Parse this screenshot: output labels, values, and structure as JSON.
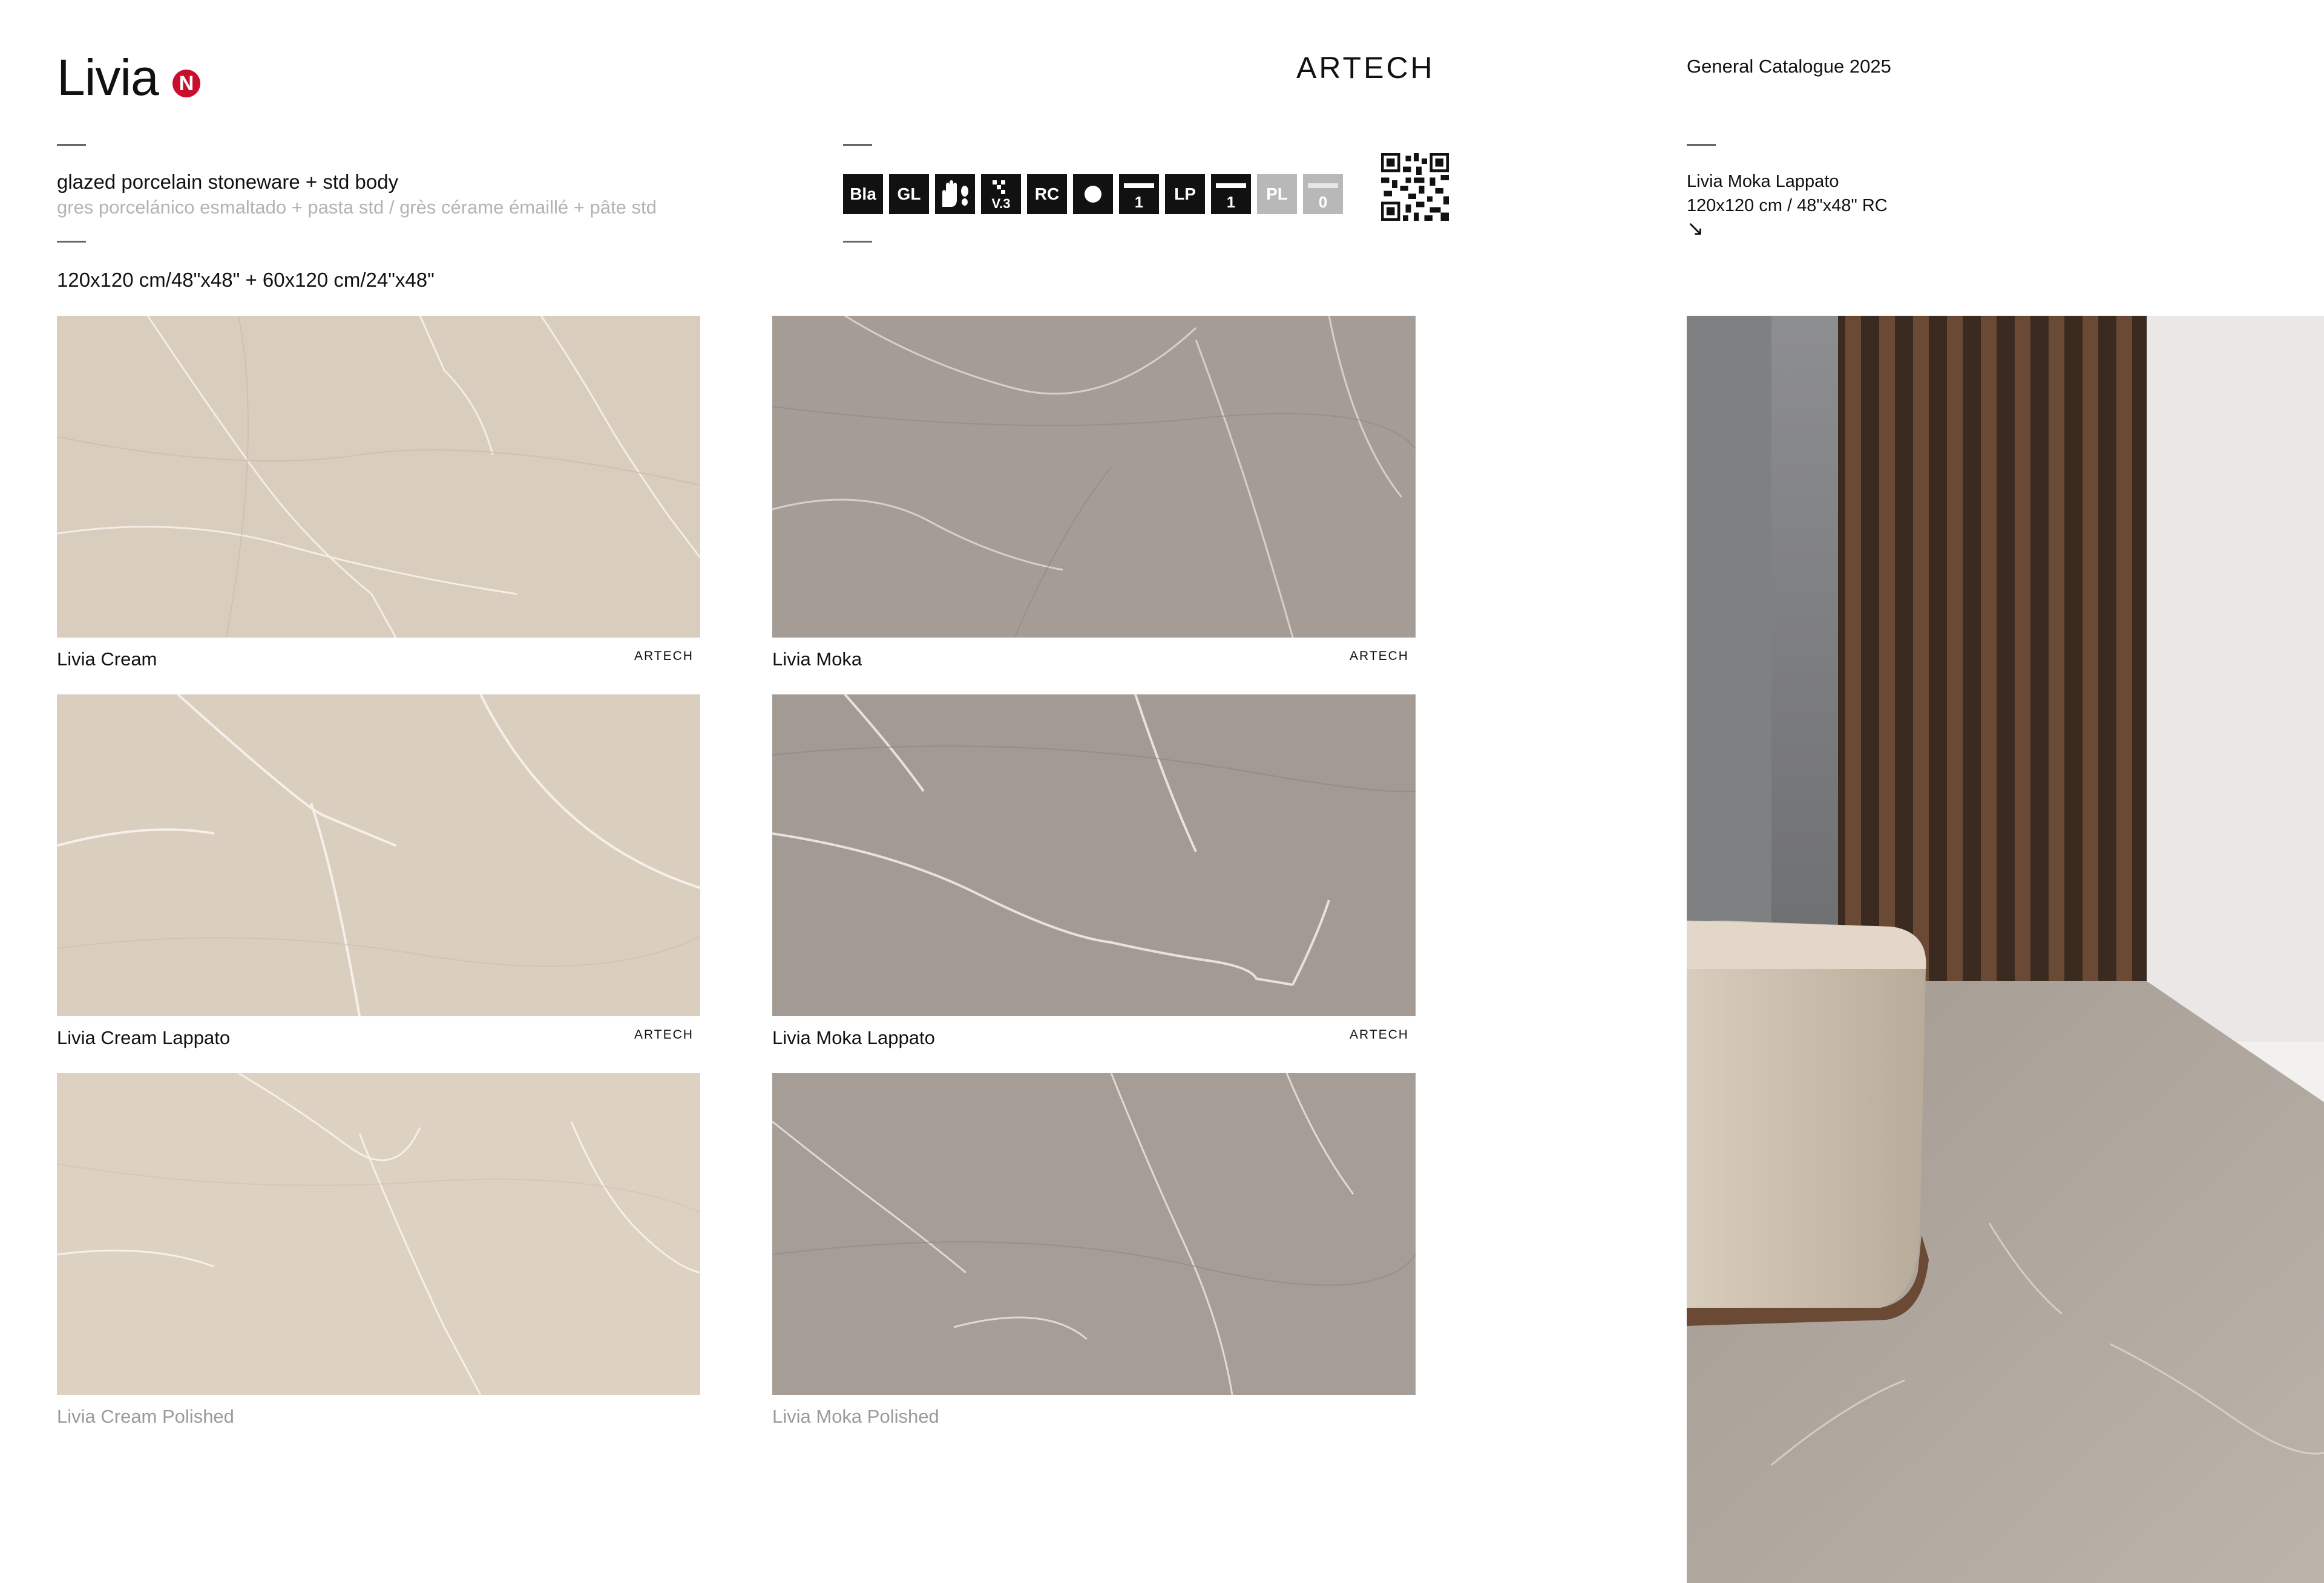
{
  "header": {
    "collection": "Livia",
    "new_badge": "N",
    "brand": "ARTECH",
    "catalogue": "General Catalogue 2025"
  },
  "product": {
    "type_en": "glazed porcelain stoneware + std body",
    "type_alt": "gres porcelánico esmaltado + pasta std / grès cérame émaillé + pâte std",
    "sizes": "120x120 cm/48\"x48\" + 60x120 cm/24\"x48\""
  },
  "tech_icons": [
    {
      "label": "Bla",
      "style": "dark"
    },
    {
      "label": "GL",
      "style": "dark"
    },
    {
      "label": "",
      "style": "dark",
      "icon": "hand-foot-icon"
    },
    {
      "label": "V.3",
      "style": "dark",
      "icon": "shade-variation-icon"
    },
    {
      "label": "RC",
      "style": "dark"
    },
    {
      "label": "",
      "style": "dark",
      "icon": "dot-icon"
    },
    {
      "label": "1",
      "style": "dark",
      "icon": "slip-resistance-icon"
    },
    {
      "label": "LP",
      "style": "dark"
    },
    {
      "label": "1",
      "style": "dark",
      "icon": "slip-resistance-icon"
    },
    {
      "label": "PL",
      "style": "grey"
    },
    {
      "label": "0",
      "style": "grey",
      "icon": "slip-resistance-icon"
    }
  ],
  "qr": {
    "icon": "qr-code-icon"
  },
  "samples": [
    {
      "name": "Livia Cream",
      "brand": "ARTECH",
      "finish": "matt",
      "color": "#d9cdbd",
      "muted": false
    },
    {
      "name": "Livia Moka",
      "brand": "ARTECH",
      "finish": "matt",
      "color": "#a59d95",
      "muted": false
    },
    {
      "name": "Livia Cream Lappato",
      "brand": "ARTECH",
      "finish": "lappato",
      "color": "#dacebf",
      "muted": false
    },
    {
      "name": "Livia Moka Lappato",
      "brand": "ARTECH",
      "finish": "lappato",
      "color": "#a39b93",
      "muted": false
    },
    {
      "name": "Livia Cream Polished",
      "brand": "",
      "finish": "polished",
      "color": "#ddd1c2",
      "muted": true
    },
    {
      "name": "Livia Moka Polished",
      "brand": "",
      "finish": "polished",
      "color": "#a69e96",
      "muted": true
    }
  ],
  "ambient": {
    "caption_line1": "Livia Moka Lappato",
    "caption_line2": "120x120 cm / 48\"x48\" RC",
    "arrow": "↘"
  },
  "colors": {
    "accent_red": "#c8102e",
    "muted_text": "#b3b3b3"
  }
}
